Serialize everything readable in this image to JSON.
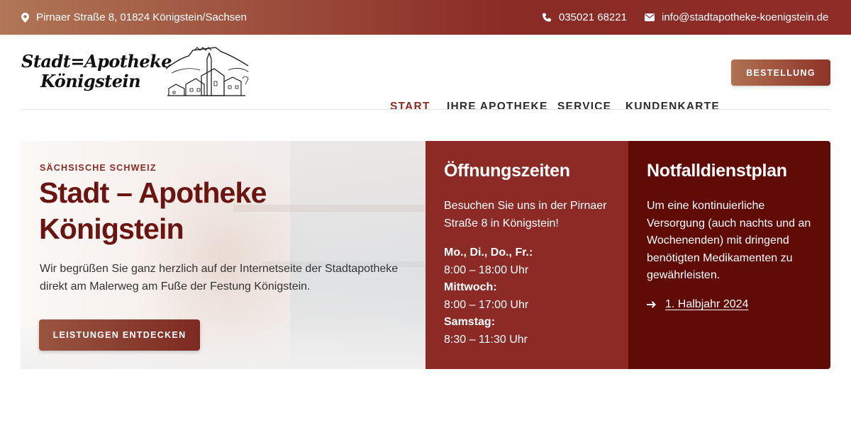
{
  "topbar": {
    "address": "Pirnaer Straße 8, 01824 Königstein/Sachsen",
    "phone": "035021 68221",
    "email": "info@stadtapotheke-koenigstein.de",
    "icons": [
      "location-pin-icon",
      "phone-icon",
      "envelope-icon"
    ]
  },
  "logo": {
    "line1": "Stadt=Apotheke",
    "line2": "Königstein"
  },
  "nav": {
    "items": [
      "START",
      "IHRE APOTHEKE",
      "SERVICE",
      "KUNDENKARTE"
    ],
    "active": "START",
    "cta": "BESTELLUNG"
  },
  "hero": {
    "kicker": "SÄCHSISCHE SCHWEIZ",
    "title_line1": "Stadt – Apotheke",
    "title_line2": "Königstein",
    "description": "Wir begrüßen Sie ganz herzlich auf der Internetseite der Stadtapotheke direkt am Malerweg am Fuße der Festung Königstein.",
    "button": "LEISTUNGEN ENTDECKEN"
  },
  "opening": {
    "title": "Öffnungszeiten",
    "intro": "Besuchen Sie uns in der Pirnaer Straße 8 in Königstein!",
    "hours": [
      {
        "day": "Mo., Di., Do., Fr.:",
        "time": "8:00 – 18:00 Uhr"
      },
      {
        "day": "Mittwoch:",
        "time": "8:00 – 17:00 Uhr"
      },
      {
        "day": "Samstag:",
        "time": "8:30 – 11:30 Uhr"
      }
    ]
  },
  "emergency": {
    "title": "Notfalldienstplan",
    "text": "Um eine kontinuierliche Versorgung (auch nachts und an Wochenenden) mit dringend benötigten Medikamenten zu gewährleisten.",
    "link": "1. Halbjahr 2024",
    "link_icon": "arrow-right-icon"
  },
  "colors": {
    "brand": "#8c2b25",
    "dark_brand": "#610b07",
    "title": "#6b1512"
  }
}
